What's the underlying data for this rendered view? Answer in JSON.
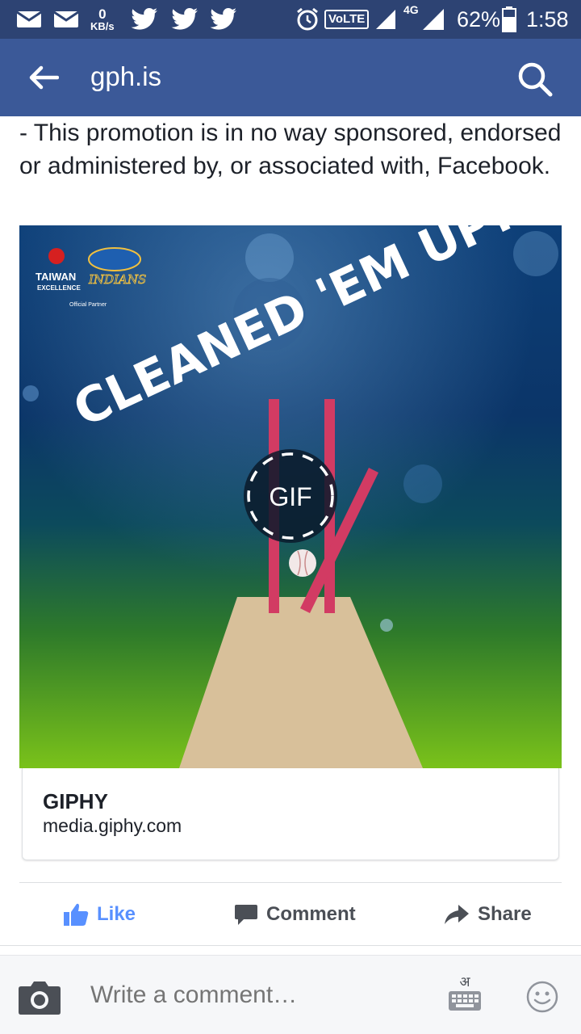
{
  "status_bar": {
    "speed_value": "0",
    "speed_unit": "KB/s",
    "volte": "VoLTE",
    "network": "4G",
    "battery": "62%",
    "time": "1:58",
    "icons": [
      "mail-icon",
      "mail-icon",
      "twitter-icon",
      "twitter-icon",
      "twitter-icon",
      "alarm-icon",
      "signal-icon",
      "battery-icon"
    ]
  },
  "app_bar": {
    "url": "gph.is",
    "color": "#3b5998"
  },
  "post": {
    "text": "- This promotion is in no way sponsored, endorsed or administered by, or associated with, Facebook."
  },
  "gif": {
    "headline": "CLEANED 'EM UP!",
    "badge": "GIF",
    "sponsor_brand": "TAIWAN",
    "sponsor_sub": "EXCELLENCE",
    "team": "INDIANS",
    "partner": "Official Partner"
  },
  "link_card": {
    "title": "GIPHY",
    "domain": "media.giphy.com"
  },
  "actions": {
    "like": "Like",
    "comment": "Comment",
    "share": "Share",
    "like_color": "#5890ff"
  },
  "comment_bar": {
    "placeholder": "Write a comment…",
    "keyboard_label": "अ"
  }
}
